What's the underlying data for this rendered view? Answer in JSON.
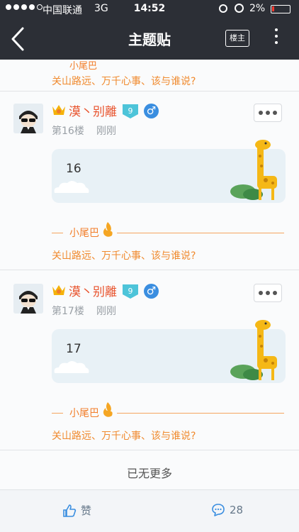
{
  "status_bar": {
    "carrier": "中国联通",
    "network": "3G",
    "time": "14:52",
    "battery": "2%"
  },
  "nav": {
    "title": "主题贴",
    "owner_label": "楼主"
  },
  "tail": {
    "label": "小尾巴",
    "signature": "关山路远、万千心事、该与谁说?"
  },
  "posts": [
    {
      "username": "漠丶别離",
      "level": "9",
      "gender_symbol": "♂",
      "floor": "第16楼",
      "time": "刚刚",
      "content": "16",
      "tail_label": "小尾巴",
      "signature": "关山路远、万千心事、该与谁说?"
    },
    {
      "username": "漠丶别離",
      "level": "9",
      "gender_symbol": "♂",
      "floor": "第17楼",
      "time": "刚刚",
      "content": "17",
      "tail_label": "小尾巴",
      "signature": "关山路远、万千心事、该与谁说?"
    }
  ],
  "footer": {
    "no_more": "已无更多"
  },
  "bottom_bar": {
    "like_label": "赞",
    "reply_count": "28"
  },
  "colors": {
    "header_bg": "#2c2f36",
    "username": "#e8532d",
    "tail_orange": "#f27e2a",
    "level_badge": "#4dc4d9",
    "gender_blue": "#3a8ee0",
    "bottom_icon": "#3a8ee0"
  }
}
